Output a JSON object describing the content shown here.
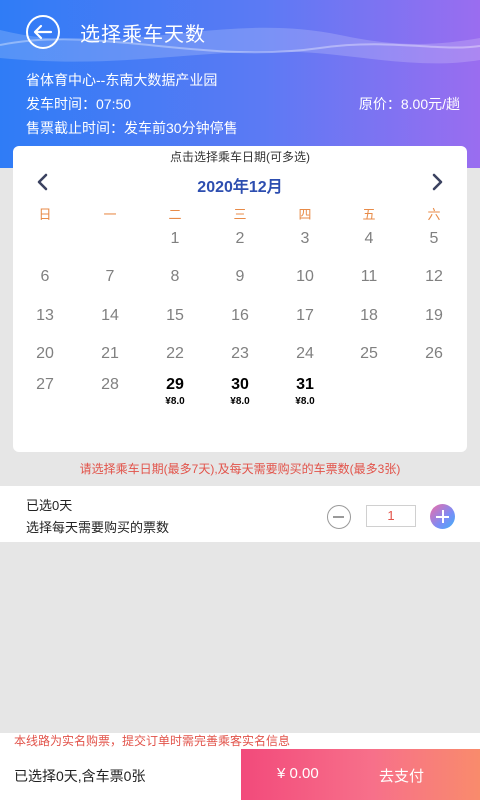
{
  "header": {
    "title": "选择乘车天数",
    "route": "省体育中心--东南大数据产业园",
    "departure": "发车时间：07:50",
    "original_price": "原价：8.00元/趟",
    "cutoff": "售票截止时间：发车前30分钟停售"
  },
  "calendar": {
    "hint": "点击选择乘车日期(可多选)",
    "month": "2020年12月",
    "weekdays": [
      "日",
      "一",
      "二",
      "三",
      "四",
      "五",
      "六"
    ],
    "weeks": [
      [
        {
          "d": ""
        },
        {
          "d": ""
        },
        {
          "d": "1"
        },
        {
          "d": "2"
        },
        {
          "d": "3"
        },
        {
          "d": "4"
        },
        {
          "d": "5"
        }
      ],
      [
        {
          "d": "6"
        },
        {
          "d": "7"
        },
        {
          "d": "8"
        },
        {
          "d": "9"
        },
        {
          "d": "10"
        },
        {
          "d": "11"
        },
        {
          "d": "12"
        }
      ],
      [
        {
          "d": "13"
        },
        {
          "d": "14"
        },
        {
          "d": "15"
        },
        {
          "d": "16"
        },
        {
          "d": "17"
        },
        {
          "d": "18"
        },
        {
          "d": "19"
        }
      ],
      [
        {
          "d": "20"
        },
        {
          "d": "21"
        },
        {
          "d": "22"
        },
        {
          "d": "23"
        },
        {
          "d": "24"
        },
        {
          "d": "25"
        },
        {
          "d": "26"
        }
      ],
      [
        {
          "d": "27"
        },
        {
          "d": "28"
        },
        {
          "d": "29",
          "price": "¥8.0",
          "sel": true
        },
        {
          "d": "30",
          "price": "¥8.0",
          "sel": true
        },
        {
          "d": "31",
          "price": "¥8.0",
          "sel": true
        },
        {
          "d": ""
        },
        {
          "d": ""
        }
      ]
    ],
    "accent_color": "#2d4eb0",
    "weekday_color": "#e88b48"
  },
  "notice": "请选择乘车日期(最多7天),及每天需要购买的车票数(最多3张)",
  "ticket_panel": {
    "selected_days": "已选0天",
    "label": "选择每天需要购买的票数",
    "quantity": "1"
  },
  "realname_note": "本线路为实名购票，提交订单时需完善乘客实名信息",
  "footer": {
    "summary": "已选择0天,含车票0张",
    "amount": "¥  0.00",
    "pay_label": "去支付"
  },
  "icons": {
    "back": "arrow-left-circle-icon",
    "prev": "chevron-left-icon",
    "next": "chevron-right-icon",
    "minus": "minus-circle-icon",
    "plus": "plus-circle-icon"
  }
}
